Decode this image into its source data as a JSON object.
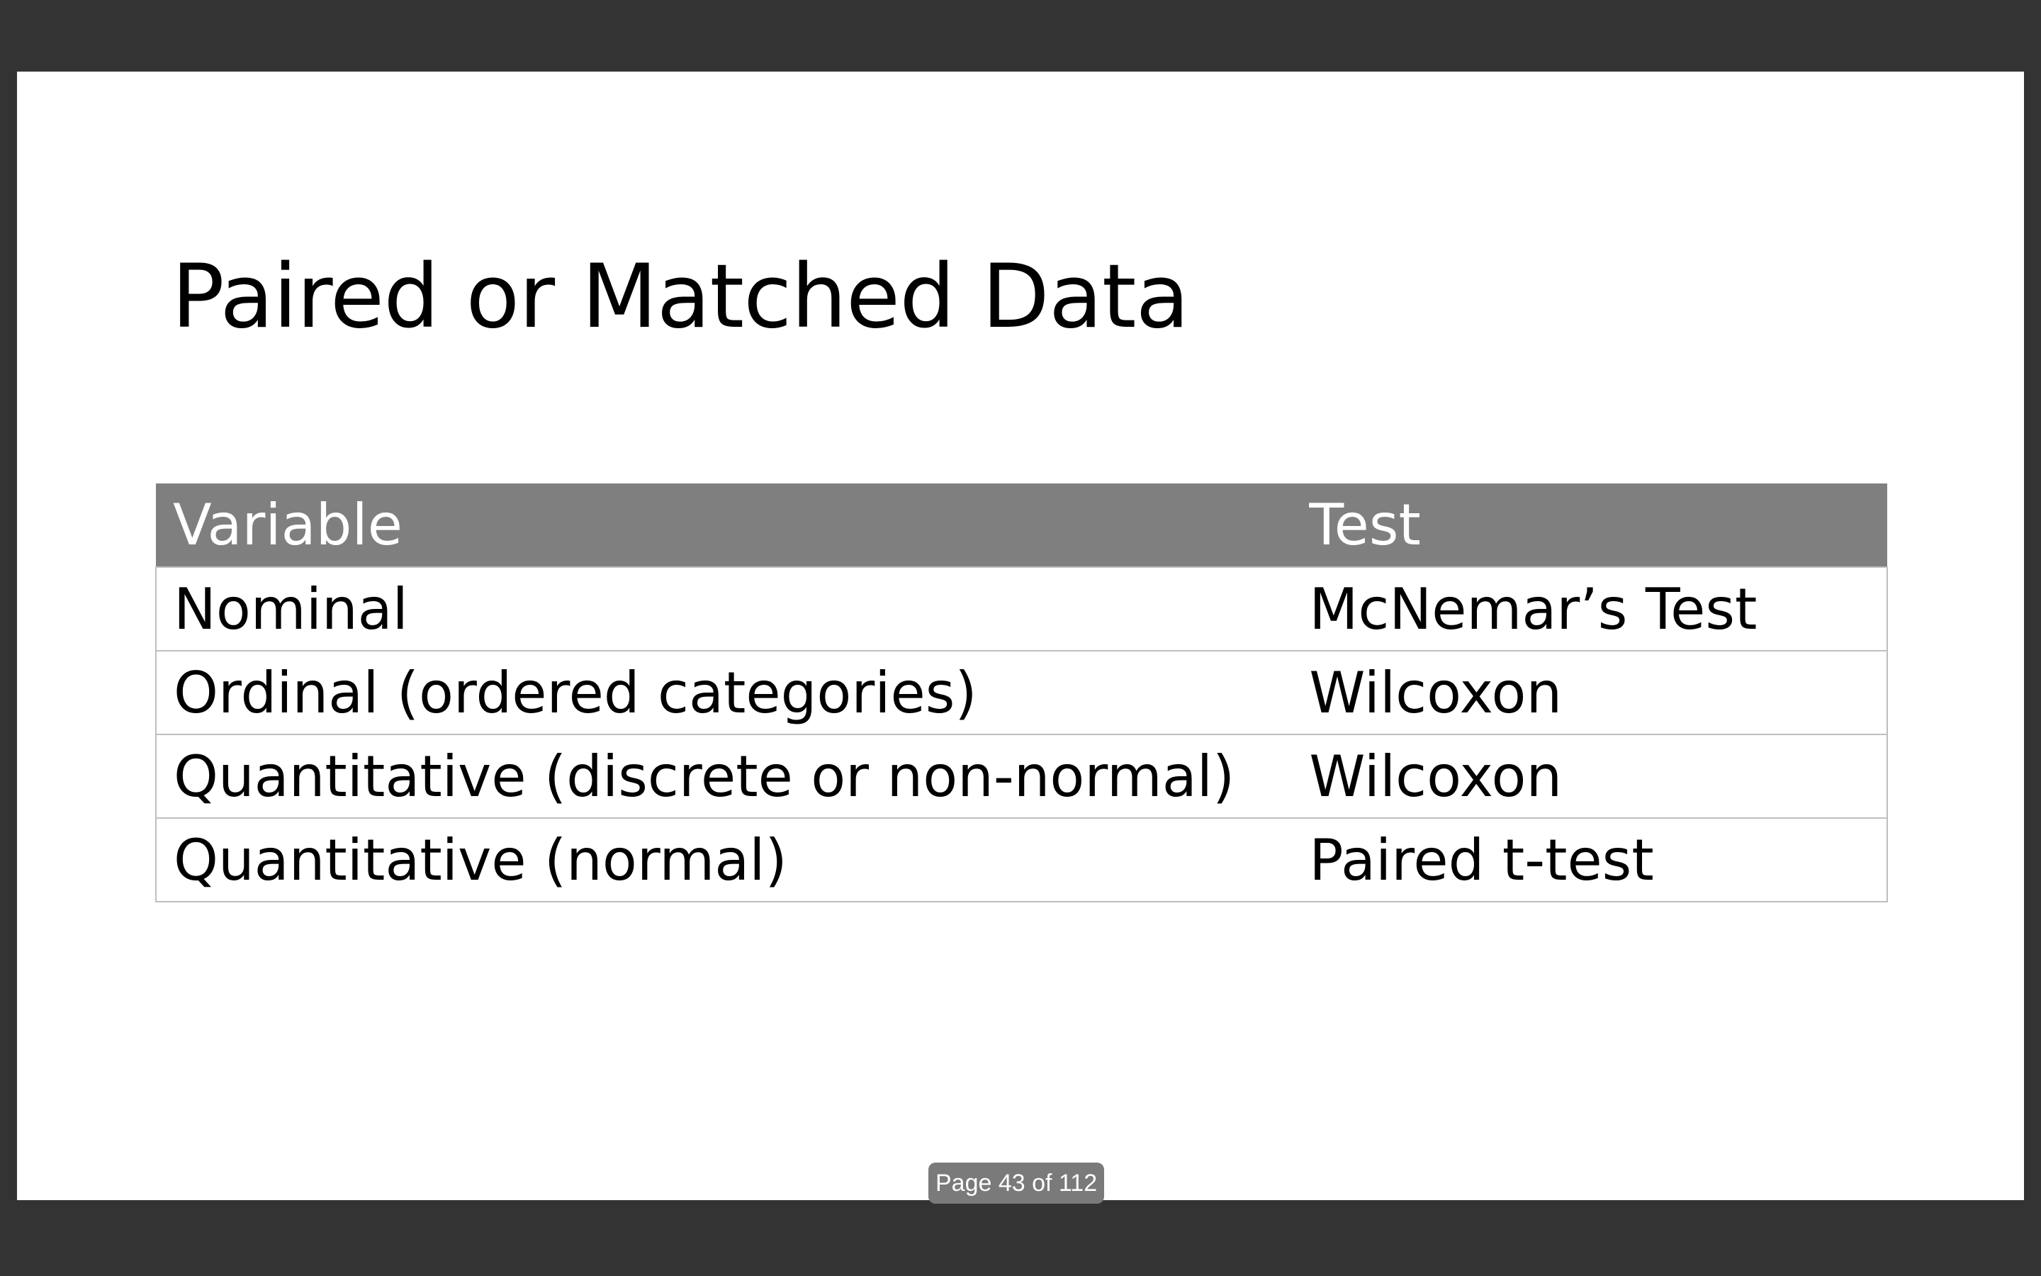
{
  "slide": {
    "title": "Paired or Matched Data",
    "table": {
      "headers": [
        "Variable",
        "Test"
      ],
      "rows": [
        [
          "Nominal",
          "McNemar’s Test"
        ],
        [
          "Ordinal (ordered categories)",
          "Wilcoxon"
        ],
        [
          "Quantitative (discrete or non-normal)",
          "Wilcoxon"
        ],
        [
          "Quantitative (normal)",
          "Paired t-test"
        ]
      ]
    }
  },
  "viewer": {
    "page_indicator": "Page 43 of 112"
  },
  "colors": {
    "viewer_background": "#333333",
    "slide_background": "#ffffff",
    "table_header": "#7f7f7f",
    "table_border": "#bfbfbf"
  }
}
